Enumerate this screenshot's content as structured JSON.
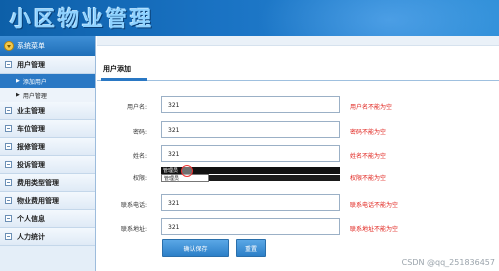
{
  "header": {
    "title": "小区物业管理"
  },
  "sidebar": {
    "heading": "系统菜单",
    "groups": [
      {
        "label": "用户管理",
        "children": [
          {
            "label": "添加用户",
            "active": true
          },
          {
            "label": "用户管理",
            "active": false
          }
        ]
      },
      {
        "label": "业主管理"
      },
      {
        "label": "车位管理"
      },
      {
        "label": "报修管理"
      },
      {
        "label": "投诉管理"
      },
      {
        "label": "费用类型管理"
      },
      {
        "label": "物业费用管理"
      },
      {
        "label": "个人信息"
      },
      {
        "label": "人力统计"
      }
    ]
  },
  "main": {
    "tab": "用户添加",
    "form": {
      "username": {
        "label": "用户名:",
        "value": "321",
        "error": "用户名不能为空"
      },
      "password": {
        "label": "密码:",
        "value": "321",
        "error": "密码不能为空"
      },
      "name": {
        "label": "姓名:",
        "value": "321",
        "error": "姓名不能为空"
      },
      "role": {
        "label": "权限:",
        "options": [
          "管理员",
          "管理员"
        ],
        "error": "权限不能为空"
      },
      "phone": {
        "label": "联系电话:",
        "value": "321",
        "error": "联系电话不能为空"
      },
      "address": {
        "label": "联系地址:",
        "value": "321",
        "error": "联系地址不能为空"
      }
    },
    "buttons": {
      "save": "确认保存",
      "reset": "重置"
    }
  },
  "watermark": "CSDN @qq_251836457",
  "colors": {
    "accent": "#2a78c4",
    "error": "#e0201a",
    "banner": "#1a73c4"
  }
}
